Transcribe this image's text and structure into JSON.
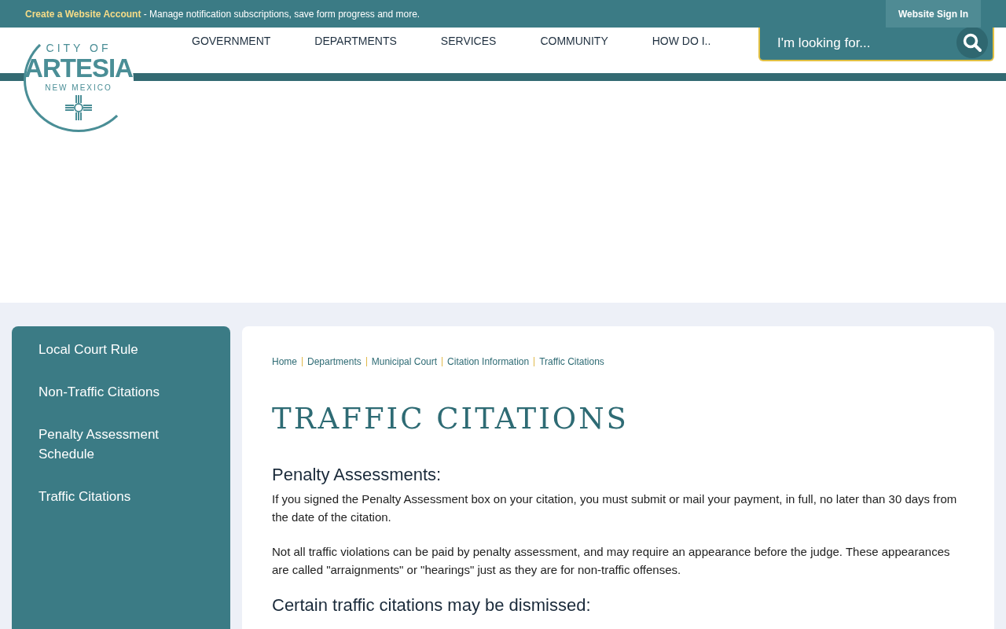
{
  "top_bar": {
    "account_link": "Create a Website Account",
    "account_text": " - Manage notification subscriptions, save form progress and more.",
    "sign_in": "Website Sign In"
  },
  "logo": {
    "line_1": "CITY OF",
    "line_2": "ARTESIA",
    "line_3": "NEW MEXICO"
  },
  "nav": [
    {
      "label": "GOVERNMENT"
    },
    {
      "label": "DEPARTMENTS"
    },
    {
      "label": "SERVICES"
    },
    {
      "label": "COMMUNITY"
    },
    {
      "label": "HOW DO I.."
    }
  ],
  "search": {
    "placeholder": "I'm looking for..."
  },
  "sidebar": {
    "items": [
      {
        "label": "Local Court Rule"
      },
      {
        "label": "Non-Traffic Citations"
      },
      {
        "label": "Penalty Assessment Schedule"
      },
      {
        "label": "Traffic Citations"
      }
    ]
  },
  "breadcrumb": [
    "Home",
    "Departments",
    "Municipal Court",
    "Citation Information",
    "Traffic Citations"
  ],
  "page_title": "TRAFFIC CITATIONS",
  "sections": [
    {
      "heading": "Penalty Assessments:",
      "paragraphs": [
        "If you signed the Penalty Assessment box on your citation, you must submit or mail your payment, in full, no later than 30 days from the date of the citation.",
        "Not all traffic violations can be paid by penalty assessment, and may require an appearance before the judge. These appearances are called \"arraignments\" or \"hearings\" just as they are for non-traffic offenses."
      ]
    },
    {
      "heading": "Certain traffic citations may be dismissed:"
    }
  ]
}
